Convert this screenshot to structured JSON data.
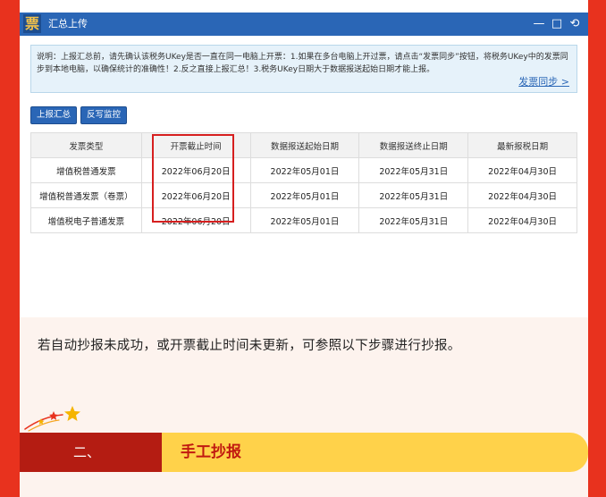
{
  "window": {
    "app_icon_glyph": "票",
    "title": "汇总上传",
    "controls": {
      "minimize": "—",
      "maximize": "□",
      "back": "⟲"
    }
  },
  "notice": {
    "text": "说明：上报汇总前，请先确认该税务UKey是否一直在同一电脑上开票：1.如果在多台电脑上开过票，请点击“发票同步”按钮，将税务UKey中的发票同步到本地电脑，以确保统计的准确性！2.反之直接上报汇总！3.税务UKey日期大于数据报送起始日期才能上报。",
    "sync_link": "发票同步 >"
  },
  "buttons": {
    "report_summary": "上报汇总",
    "write_back": "反写监控"
  },
  "table": {
    "headers": [
      "发票类型",
      "开票截止时间",
      "数据报送起始日期",
      "数据报送终止日期",
      "最新报税日期"
    ],
    "rows": [
      [
        "增值税普通发票",
        "2022年06月20日",
        "2022年05月01日",
        "2022年05月31日",
        "2022年04月30日"
      ],
      [
        "增值税普通发票（卷票）",
        "2022年06月20日",
        "2022年05月01日",
        "2022年05月31日",
        "2022年04月30日"
      ],
      [
        "增值税电子普通发票",
        "2022年06月20日",
        "2022年05月01日",
        "2022年05月31日",
        "2022年04月30日"
      ]
    ]
  },
  "body_text": "若自动抄报未成功，或开票截止时间未更新，可参照以下步骤进行抄报。",
  "section": {
    "number": "二、",
    "title": "手工抄报"
  },
  "colors": {
    "outer_red": "#e8321e",
    "title_blue": "#2a66b6",
    "section_yellow": "#ffd24a",
    "section_dark_red": "#b41c12",
    "highlight_red": "#d61f1f"
  }
}
